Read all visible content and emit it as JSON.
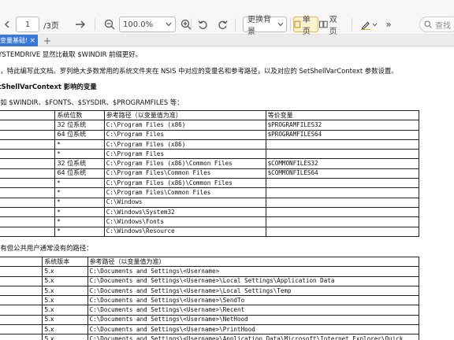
{
  "toolbar": {
    "page_current": "1",
    "page_total": "/3页",
    "zoom": "100.0%",
    "background_label": "更换背景",
    "single_page_label": "单页",
    "double_page_label": "双页",
    "search_placeholder": "查找"
  },
  "tabs": [
    {
      "label": "变量基础!"
    }
  ],
  "doc": {
    "line1": "SYSTEMDRIVE 显然比截取 $WINDIR 前缀更好。",
    "line2": "段，特此编写此文档。罗列绝大多数常用的系统文件夹在 NSIS 中对应的变量名和参考路径，以及对应的 SetShellVarContext 参数设置。",
    "heading": "etShellVarContext 影响的变量",
    "line3": "量如 $WINDIR、$FONTS、$SYSDIR、$PROGRAMFILES 等：",
    "table1": {
      "headers": [
        "",
        "系统位数",
        "参考路径（以变量值为准）",
        "等价变量"
      ],
      "rows": [
        [
          "ILES",
          "32 位系统",
          "C:\\Program Files (x86)",
          "$PROGRAMFILES32"
        ],
        [
          "",
          "64 位系统",
          "C:\\Program Files",
          "$PROGRAMFILES64"
        ],
        [
          "ILES32",
          "*",
          "C:\\Program Files (x86)",
          ""
        ],
        [
          "ILES64",
          "*",
          "C:\\Program Files",
          ""
        ],
        [
          "ILES",
          "32 位系统",
          "C:\\Program Files (x86)\\Common Files",
          "$COMMONFILES32"
        ],
        [
          "",
          "64 位系统",
          "C:\\Program Files\\Common Files",
          "$COMMONFILES64"
        ],
        [
          "LES32",
          "*",
          "C:\\Program Files (x86)\\Common Files",
          ""
        ],
        [
          "LES64",
          "*",
          "C:\\Program Files\\Common Files",
          ""
        ],
        [
          "",
          "*",
          "C:\\Windows",
          ""
        ],
        [
          "",
          "*",
          "C:\\Windows\\System32",
          ""
        ],
        [
          "",
          "*",
          "C:\\Windows\\Fonts",
          ""
        ],
        [
          "",
          "*",
          "C:\\Windows\\Resource",
          ""
        ]
      ]
    },
    "line4": "户有但公共用户通常没有的路径：",
    "table2": {
      "headers": [
        "",
        "系统版本",
        "参考路径（以变量值为准）"
      ],
      "rows": [
        [
          "",
          "5.x",
          "C:\\Documents and Settings\\<Username>"
        ],
        [
          "DATA",
          "5.x",
          "C:\\Documents and Settings\\<Username>\\Local Settings\\Application Data"
        ],
        [
          "",
          "5.x",
          "C:\\Documents and Settings\\<Username>\\Local Settings\\Temp"
        ],
        [
          "",
          "5.x",
          "C:\\Documents and Settings\\<Username>\\SendTo"
        ],
        [
          "",
          "5.x",
          "C:\\Documents and Settings\\<Username>\\Recent"
        ],
        [
          "",
          "5.x",
          "C:\\Documents and Settings\\<Username>\\NetHood"
        ],
        [
          "D",
          "5.x",
          "C:\\Documents and Settings\\<Username>\\PrintHood"
        ],
        [
          "NCH",
          "5.x",
          "C:\\Documents and Settings\\<Username>\\Application Data\\Microsoft\\Internet Explorer\\Quick"
        ]
      ]
    }
  },
  "colors": {
    "accent": "#3a78d8",
    "active_toggle": "#fff2cf",
    "pen": "#e3b21b"
  }
}
